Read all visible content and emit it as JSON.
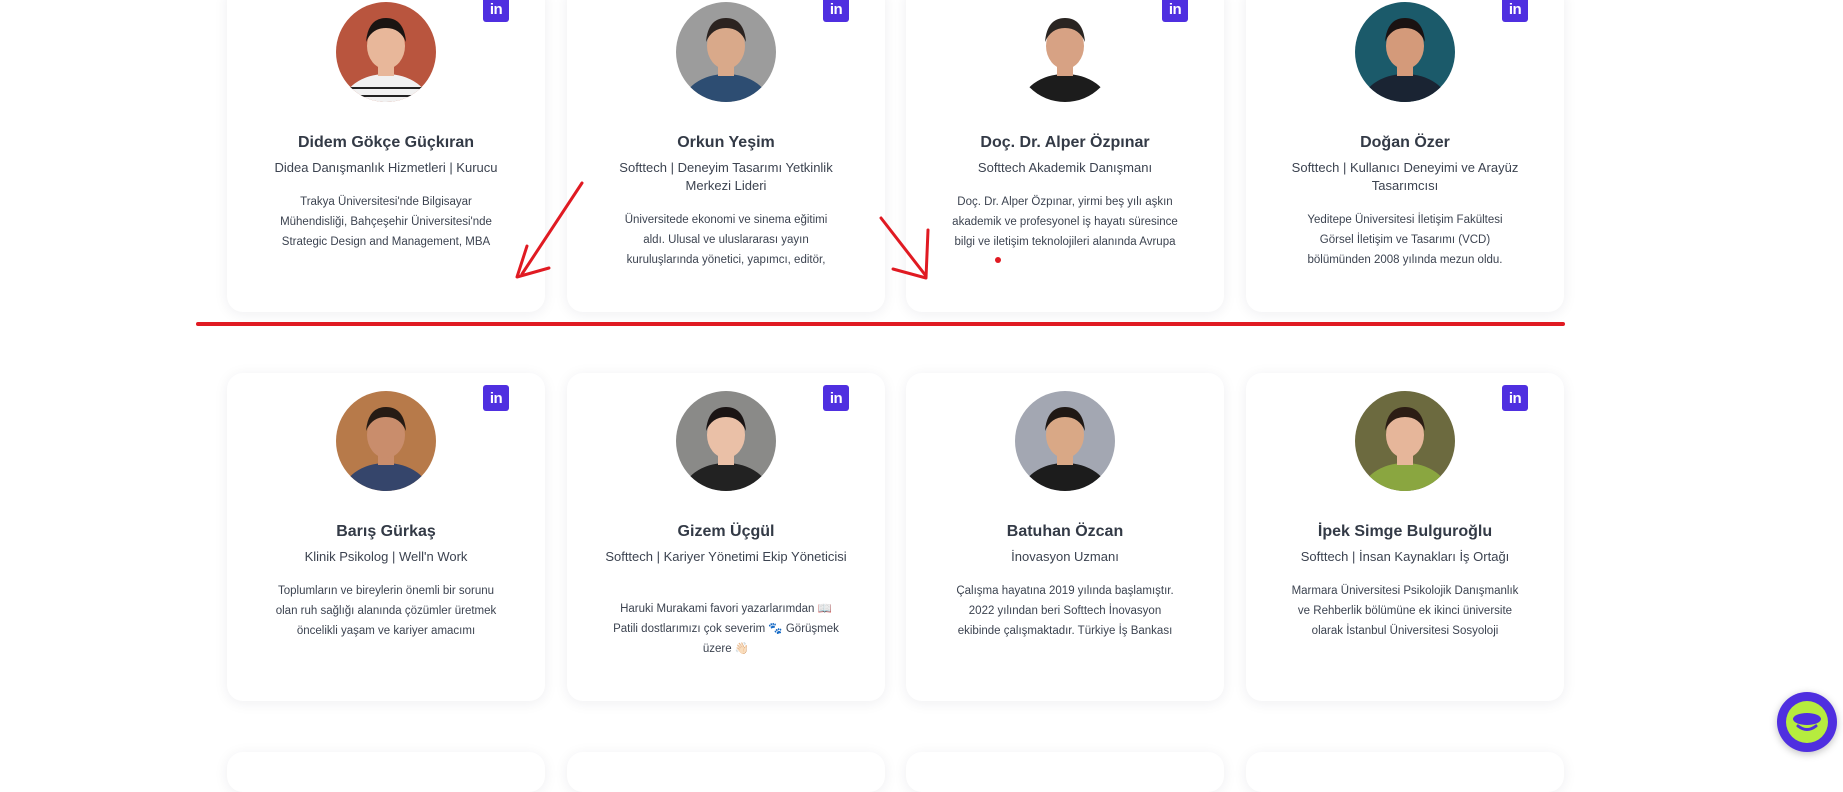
{
  "colors": {
    "accent": "#4f2fe0",
    "annotation": "#e01a22",
    "chat_face": "#b6ec3e"
  },
  "linkedin_icon_text": "in",
  "members": [
    {
      "name": "Didem Gökçe Güçkıran",
      "role": "Didea Danışmanlık Hizmetleri | Kurucu",
      "bio": [
        "Trakya Üniversitesi'nde Bilgisayar",
        "Mühendisliği, Bahçeşehir Üniversitesi'nde",
        "Strategic Design and Management, MBA"
      ]
    },
    {
      "name": "Orkun Yeşim",
      "role": "Softtech | Deneyim Tasarımı Yetkinlik Merkezi Lideri",
      "bio": [
        "Üniversitede ekonomi ve sinema eğitimi",
        "aldı. Ulusal ve uluslararası yayın",
        "kuruluşlarında yönetici, yapımcı, editör,"
      ]
    },
    {
      "name": "Doç. Dr. Alper Özpınar",
      "role": "Softtech Akademik Danışmanı",
      "bio": [
        "Doç. Dr. Alper Özpınar, yirmi beş yılı aşkın",
        "akademik ve profesyonel iş hayatı süresince",
        "bilgi ve iletişim teknolojileri alanında Avrupa"
      ]
    },
    {
      "name": "Doğan Özer",
      "role": "Softtech | Kullanıcı Deneyimi ve Arayüz Tasarımcısı",
      "bio": [
        "Yeditepe Üniversitesi İletişim Fakültesi",
        "Görsel İletişim ve Tasarımı (VCD)",
        "bölümünden 2008 yılında mezun oldu."
      ]
    },
    {
      "name": "Barış Gürkaş",
      "role": "Klinik Psikolog | Well'n Work",
      "bio": [
        "Toplumların ve bireylerin önemli bir sorunu",
        "olan ruh sağlığı alanında çözümler üretmek",
        "öncelikli yaşam ve kariyer amacımı"
      ]
    },
    {
      "name": "Gizem Üçgül",
      "role": "Softtech | Kariyer Yönetimi Ekip Yöneticisi",
      "bio": [
        "Haruki Murakami favori yazarlarımdan 📖",
        "Patili dostlarımızı çok severim 🐾 Görüşmek",
        "üzere 👋🏻"
      ]
    },
    {
      "name": "Batuhan Özcan",
      "role": "İnovasyon Uzmanı",
      "bio": [
        "Çalışma hayatına 2019 yılında başlamıştır.",
        "2022 yılından beri Softtech İnovasyon",
        "ekibinde çalışmaktadır. Türkiye İş Bankası"
      ]
    },
    {
      "name": "İpek Simge Bulguroğlu",
      "role": "Softtech | İnsan Kaynakları İş Ortağı",
      "bio": [
        "Marmara Üniversitesi Psikolojik Danışmanlık",
        "ve Rehberlik bölümüne ek ikinci üniversite",
        "olarak İstanbul Üniversitesi Sosyoloji"
      ]
    }
  ]
}
